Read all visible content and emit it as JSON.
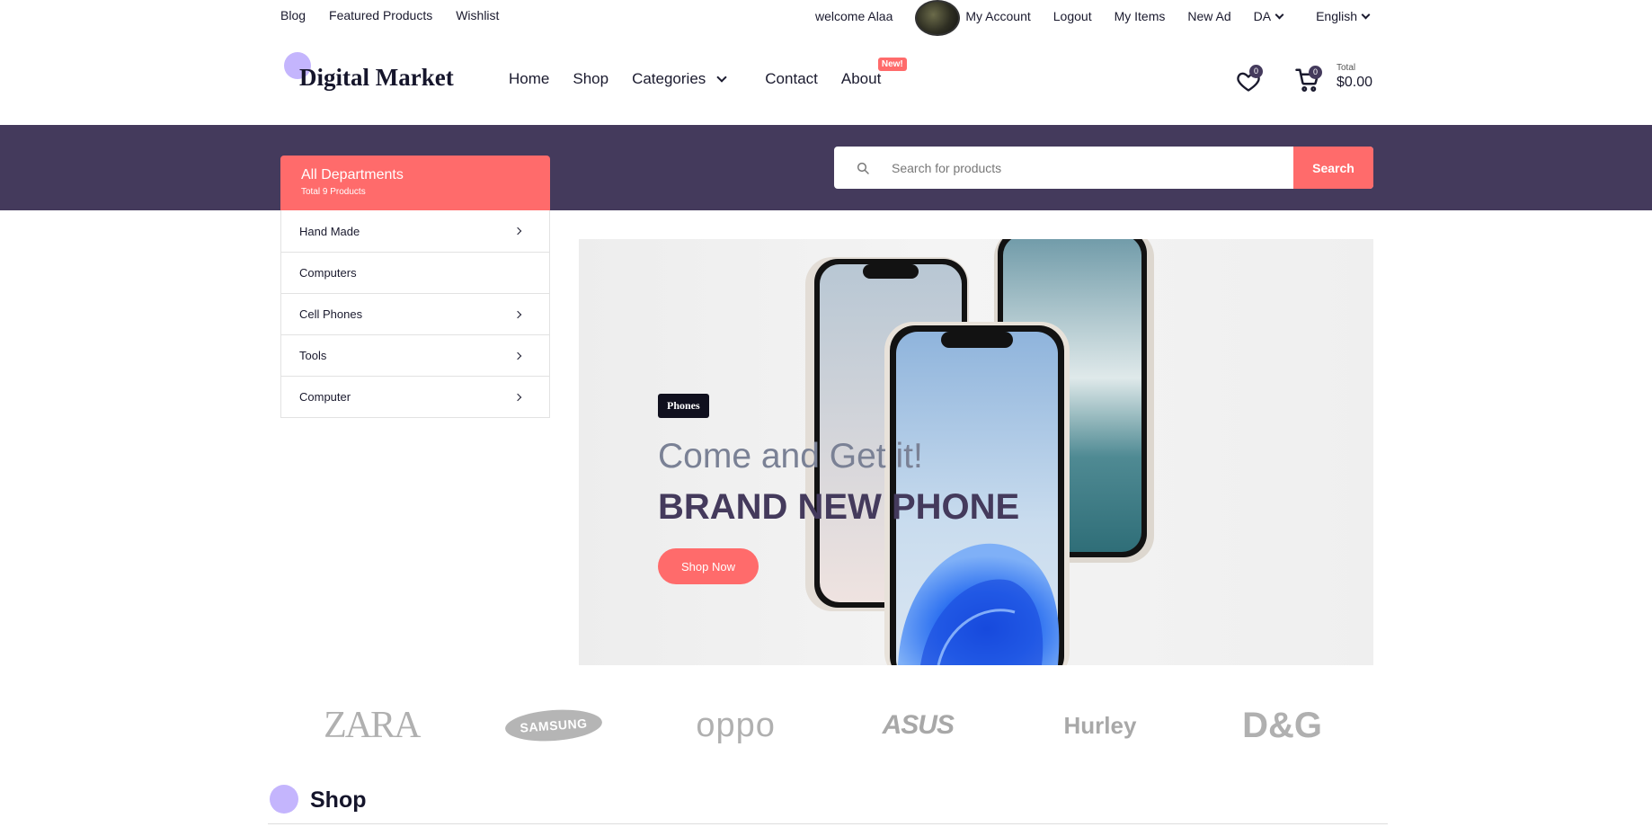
{
  "topbar": {
    "left_links": [
      "Blog",
      "Featured Products",
      "Wishlist"
    ],
    "welcome": "welcome Alaa",
    "my_account": "My Account",
    "logout": "Logout",
    "my_items": "My Items",
    "new_ad": "New Ad",
    "currency": "DA",
    "language": "English"
  },
  "header": {
    "logo": "Digital Market",
    "nav": {
      "home": "Home",
      "shop": "Shop",
      "categories": "Categories",
      "contact": "Contact",
      "about": "About",
      "about_badge": "New!"
    },
    "wishlist_count": "0",
    "cart_count": "0",
    "total_label": "Total",
    "total_amount": "$0.00"
  },
  "departments": {
    "title": "All Departments",
    "subtitle": "Total 9 Products",
    "items": [
      {
        "label": "Hand Made",
        "has_children": true
      },
      {
        "label": "Computers",
        "has_children": false
      },
      {
        "label": "Cell Phones",
        "has_children": true
      },
      {
        "label": "Tools",
        "has_children": true
      },
      {
        "label": "Computer",
        "has_children": true
      }
    ]
  },
  "search": {
    "placeholder": "Search for products",
    "button": "Search"
  },
  "hero": {
    "tag": "Phones",
    "line1": "Come and Get it!",
    "line2": "BRAND NEW PHONE",
    "button": "Shop Now"
  },
  "brands": [
    "ZARA",
    "SAMSUNG",
    "oppo",
    "ASUS",
    "Hurley",
    "D&G"
  ],
  "section": {
    "title": "Shop"
  },
  "colors": {
    "accent": "#ff6b6b",
    "band": "#443a5c",
    "logo_dot": "#c4b5fd"
  }
}
